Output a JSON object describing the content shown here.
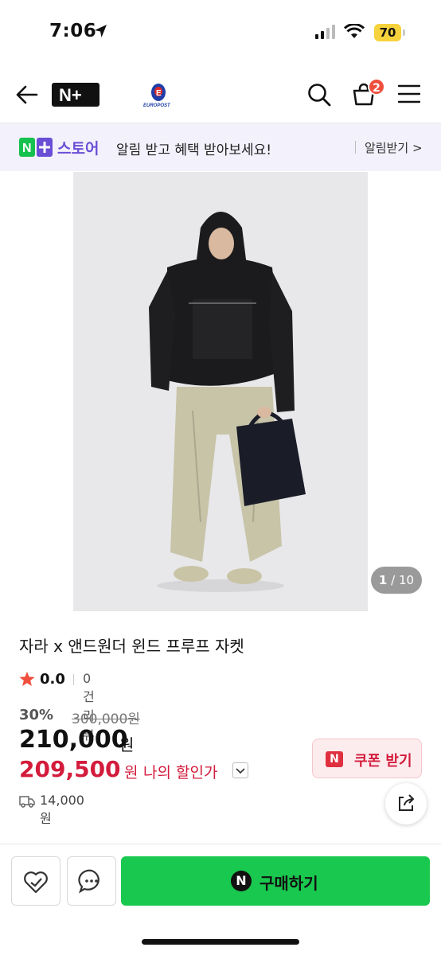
{
  "status_bar": {
    "time": "7:06",
    "battery_level": "70"
  },
  "header": {
    "logo_text": "N+",
    "brand_logo_text": "EUROPOST",
    "cart_count": "2"
  },
  "promo": {
    "logo_text": "N+",
    "store_label": "스토어",
    "message": "알림 받고 혜택 받아보세요!",
    "cta": "알림받기 >"
  },
  "gallery": {
    "current": "1",
    "total": "/ 10"
  },
  "product": {
    "title": "자라 x 앤드원더 윈드 프루프 자켓",
    "rating": "0.0",
    "review_count": "0건 리뷰",
    "discount_rate": "30%",
    "original_price": "300,000원",
    "sale_price": "210,000",
    "sale_unit": "원",
    "my_price": "209,500",
    "my_price_unit": "원",
    "my_price_label": "나의 할인가",
    "shipping_fee": "14,000원"
  },
  "coupon": {
    "icon_text": "N",
    "label": "쿠폰 받기"
  },
  "actions": {
    "buy_icon_text": "N",
    "buy_label": "구매하기"
  },
  "colors": {
    "accent_purple": "#6a4ed6",
    "price_red": "#d31b3c",
    "buy_green": "#19c84e",
    "badge_red": "#f04f3e"
  }
}
